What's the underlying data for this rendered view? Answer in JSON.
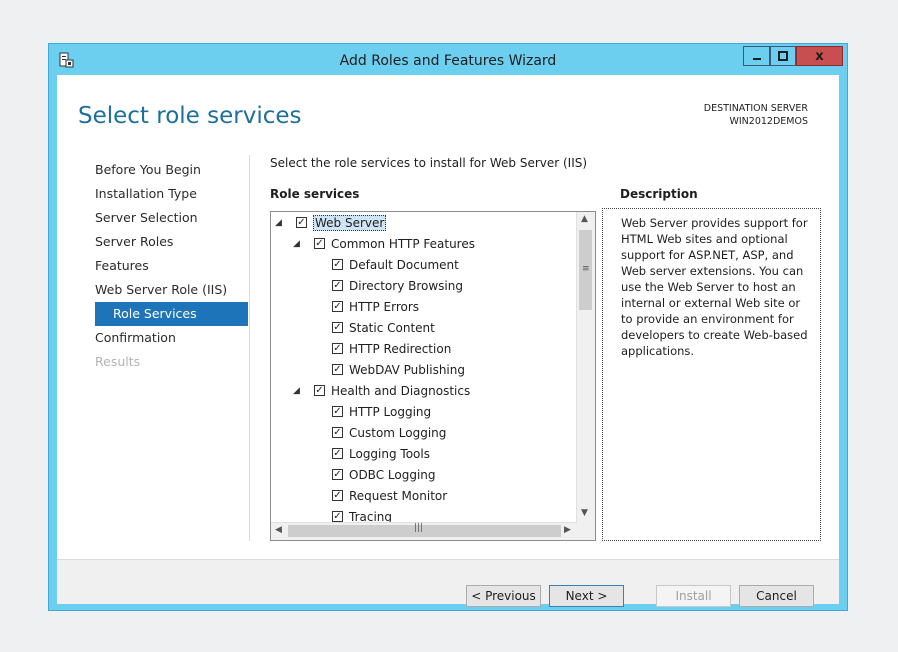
{
  "window": {
    "title": "Add Roles and Features Wizard",
    "minimize_glyph": "–",
    "maximize_glyph": "□",
    "close_glyph": "x"
  },
  "heading": "Select role services",
  "destination": {
    "label": "DESTINATION SERVER",
    "server": "WIN2012DEMOS"
  },
  "nav": [
    {
      "label": "Before You Begin"
    },
    {
      "label": "Installation Type"
    },
    {
      "label": "Server Selection"
    },
    {
      "label": "Server Roles"
    },
    {
      "label": "Features"
    },
    {
      "label": "Web Server Role (IIS)"
    },
    {
      "label": "Role Services",
      "active": true
    },
    {
      "label": "Confirmation"
    },
    {
      "label": "Results",
      "disabled": true
    }
  ],
  "instruction": "Select the role services to install for Web Server (IIS)",
  "role_services_label": "Role services",
  "tree": [
    {
      "label": "Web Server",
      "level": 0,
      "expanded": true,
      "checked": true,
      "selected": true
    },
    {
      "label": "Common HTTP Features",
      "level": 1,
      "expanded": true,
      "checked": true
    },
    {
      "label": "Default Document",
      "level": 2,
      "checked": true
    },
    {
      "label": "Directory Browsing",
      "level": 2,
      "checked": true
    },
    {
      "label": "HTTP Errors",
      "level": 2,
      "checked": true
    },
    {
      "label": "Static Content",
      "level": 2,
      "checked": true
    },
    {
      "label": "HTTP Redirection",
      "level": 2,
      "checked": true
    },
    {
      "label": "WebDAV Publishing",
      "level": 2,
      "checked": true
    },
    {
      "label": "Health and Diagnostics",
      "level": 1,
      "expanded": true,
      "checked": true
    },
    {
      "label": "HTTP Logging",
      "level": 2,
      "checked": true
    },
    {
      "label": "Custom Logging",
      "level": 2,
      "checked": true
    },
    {
      "label": "Logging Tools",
      "level": 2,
      "checked": true
    },
    {
      "label": "ODBC Logging",
      "level": 2,
      "checked": true
    },
    {
      "label": "Request Monitor",
      "level": 2,
      "checked": true
    },
    {
      "label": "Tracing",
      "level": 2,
      "checked": true
    }
  ],
  "description": {
    "label": "Description",
    "text": "Web Server provides support for HTML Web sites and optional support for ASP.NET, ASP, and Web server extensions. You can use the Web Server to host an internal or external Web site or to provide an environment for developers to create Web-based applications."
  },
  "buttons": {
    "previous": "< Previous",
    "next": "Next >",
    "install": "Install",
    "cancel": "Cancel"
  }
}
